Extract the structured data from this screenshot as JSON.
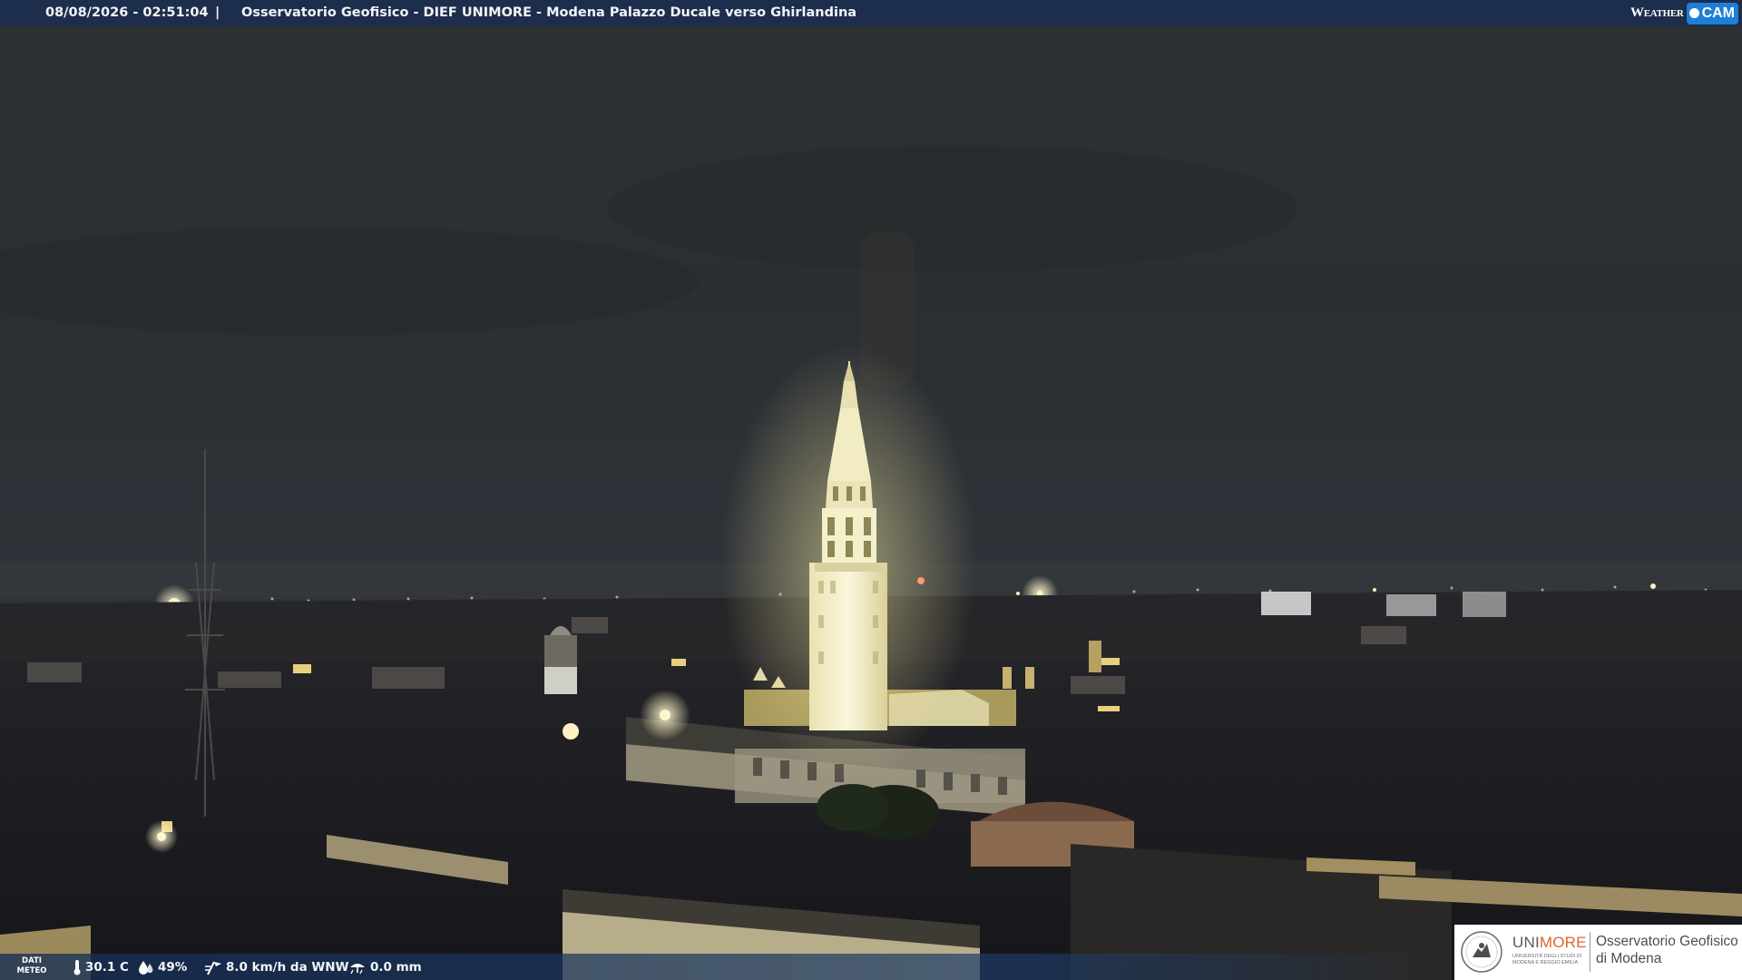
{
  "header": {
    "timestamp": "08/08/2026 - 02:51:04",
    "separator": "|",
    "title": "Osservatorio Geofisico - DIEF UNIMORE - Modena Palazzo Ducale verso Ghirlandina"
  },
  "brand": {
    "weather_text": "Weather",
    "cam_text": "CAM"
  },
  "weather_bar": {
    "label_line1": "DATI",
    "label_line2": "METEO",
    "temperature": "30.1 C",
    "humidity": "49%",
    "wind": "8.0 km/h da WNW",
    "rain": "0.0 mm",
    "icons": [
      "thermometer-icon",
      "humidity-drop-icon",
      "wind-icon",
      "rain-gauge-icon"
    ]
  },
  "logo": {
    "uni_part1": "UNI",
    "uni_part2": "MORE",
    "uni_sub": "UNIVERSITÀ DEGLI STUDI DI MODENA E REGGIO EMILIA",
    "observatory_line1": "Osservatorio Geofisico",
    "observatory_line2": "di Modena"
  },
  "colors": {
    "bar_blue": "#162e54",
    "cam_blue": "#1d7fd6",
    "unimore_orange": "#e0632d",
    "sky": "#2a2e30",
    "tower_lit": "#f4f0c8"
  }
}
